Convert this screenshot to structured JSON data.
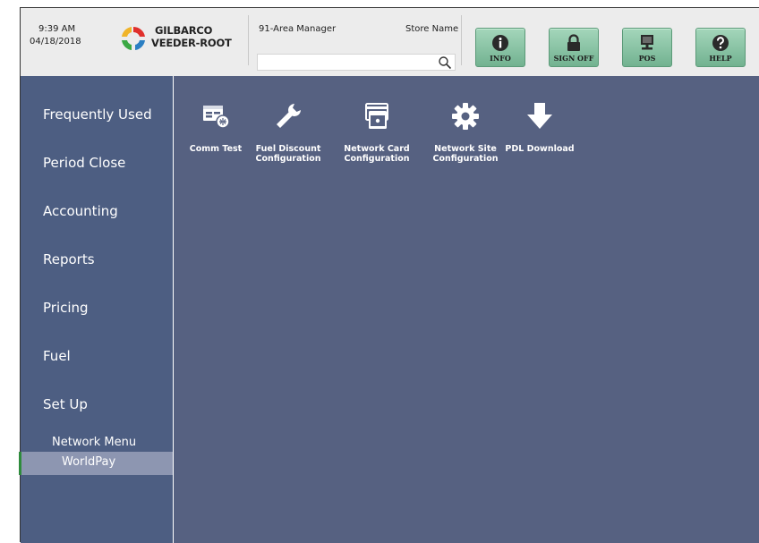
{
  "header": {
    "time": "9:39 AM",
    "date": "04/18/2018",
    "logo_line1": "GILBARCO",
    "logo_line2": "VEEDER-ROOT",
    "role": "91-Area Manager",
    "store_label": "Store Name",
    "search_value": "",
    "buttons": [
      {
        "label": "INFO",
        "icon": "info-icon"
      },
      {
        "label": "SIGN OFF",
        "icon": "lock-icon"
      },
      {
        "label": "POS",
        "icon": "monitor-icon"
      },
      {
        "label": "HELP",
        "icon": "help-icon"
      }
    ]
  },
  "sidebar": {
    "items": [
      {
        "label": "Frequently Used"
      },
      {
        "label": "Period Close"
      },
      {
        "label": "Accounting"
      },
      {
        "label": "Reports"
      },
      {
        "label": "Pricing"
      },
      {
        "label": "Fuel"
      },
      {
        "label": "Set Up"
      }
    ],
    "sub_items": [
      {
        "label": "Network Menu"
      },
      {
        "label": "WorldPay",
        "selected": true
      }
    ]
  },
  "main": {
    "tiles": [
      {
        "label": "Comm Test",
        "icon": "comm-test-icon"
      },
      {
        "label": "Fuel Discount\nConfiguration",
        "icon": "wrench-icon"
      },
      {
        "label": "Network Card\nConfiguration",
        "icon": "network-card-icon"
      },
      {
        "label": "Network Site\nConfiguration",
        "icon": "gear-icon"
      },
      {
        "label": "PDL Download",
        "icon": "download-arrow-icon"
      }
    ]
  },
  "colors": {
    "sidebar_bg": "#4d5e82",
    "main_bg": "#566181",
    "selected_bg": "#8d96b1",
    "selected_marker": "#2e8b3c",
    "toolbar_button": "#8cc6a6"
  }
}
